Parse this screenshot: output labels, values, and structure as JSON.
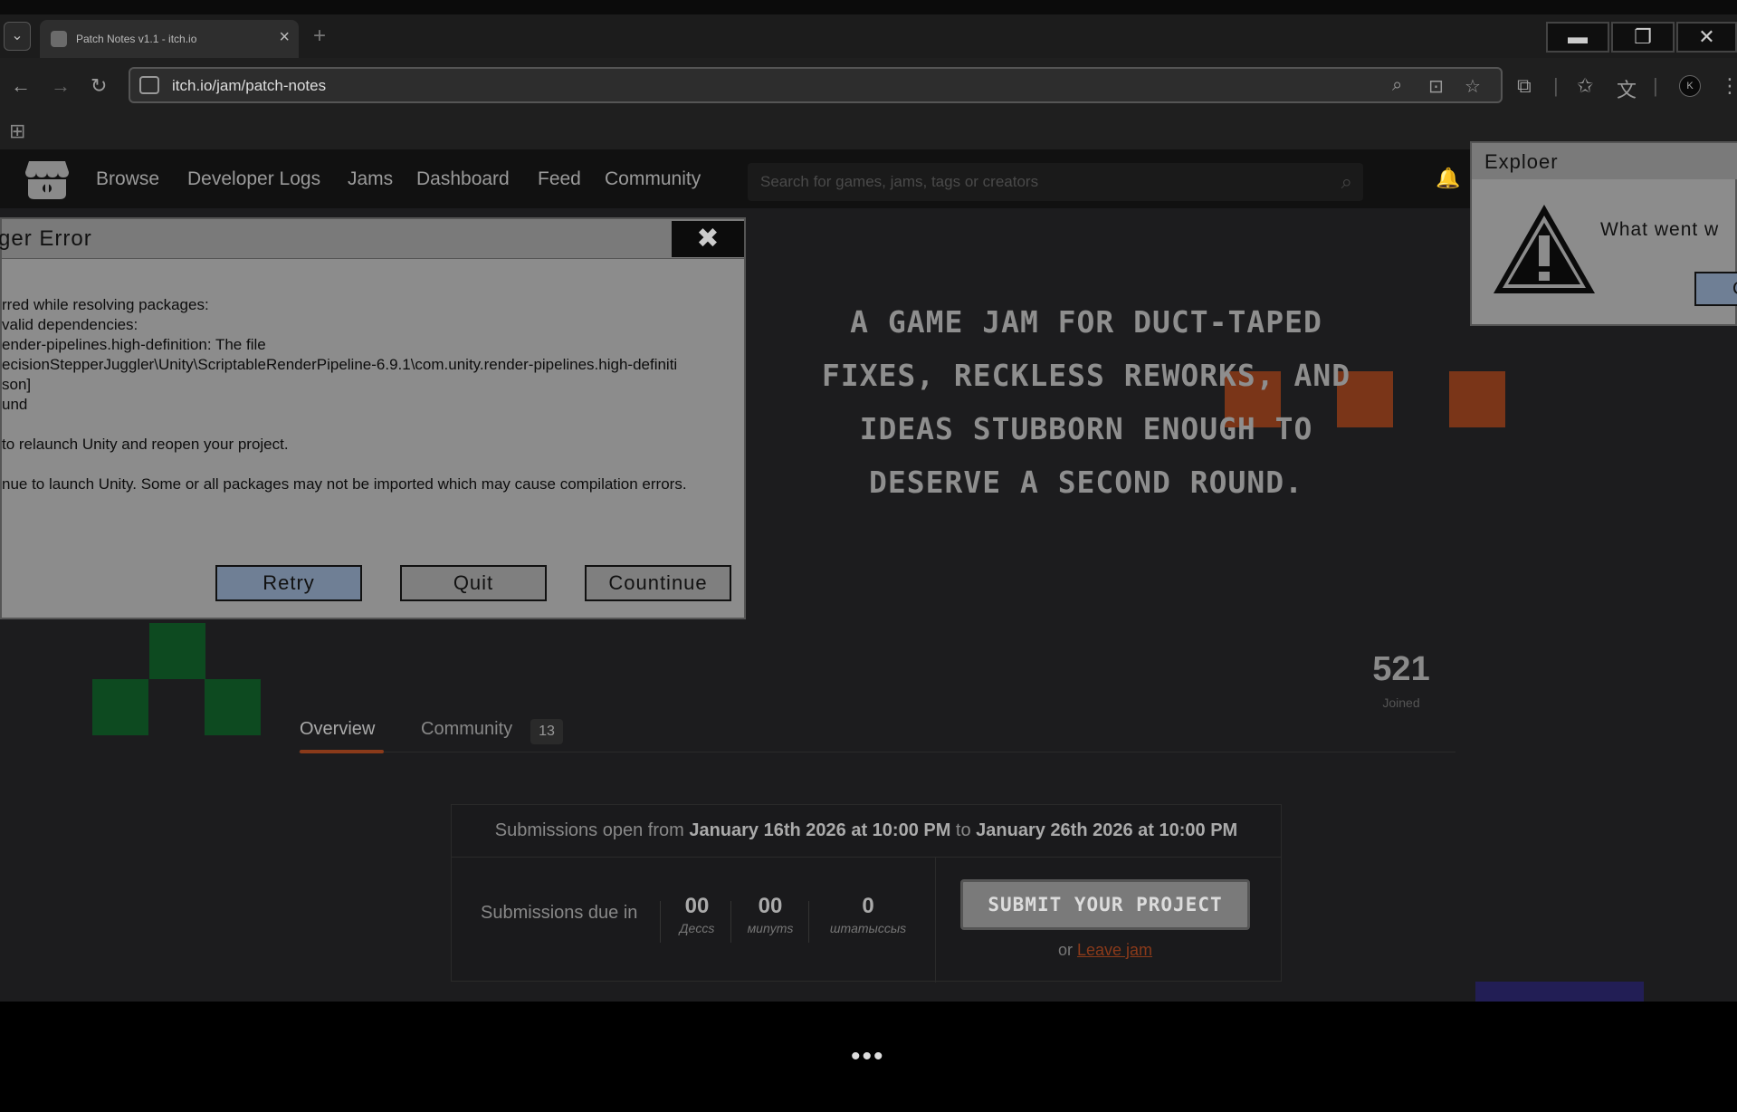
{
  "browser": {
    "tab_title": "Patch Notes v1.1 - itch.io",
    "tab_close": "×",
    "new_tab": "+",
    "url": "itch.io/jam/patch-notes",
    "avatar_letter": "K",
    "win_minimize": "▬",
    "win_restore": "❐",
    "win_close": "✕",
    "dropdown": "⌄"
  },
  "header": {
    "nav": [
      "Browse",
      "Developer Logs",
      "Jams",
      "Dashboard",
      "Feed",
      "Community"
    ],
    "search_placeholder": "Search for games, jams, tags or creators"
  },
  "hero": {
    "lines": [
      "A GAME JAM FOR DUCT-TAPED",
      "FIXES, RECKLESS REWORKS, AND",
      "IDEAS STUBBORN ENOUGH TO",
      "DESERVE A SECOND ROUND."
    ]
  },
  "stats": {
    "joined_count": "521",
    "joined_label": "Joined"
  },
  "tabs": {
    "overview": "Overview",
    "community": "Community",
    "community_count": "13"
  },
  "submissions": {
    "open_prefix": "Submissions open from ",
    "start": "January 16th 2026 at 10:00 PM",
    "to": " to ",
    "end": "January 26th 2026 at 10:00 PM",
    "due_label": "Submissions due in",
    "countdown": [
      {
        "value": "00",
        "unit": "Дecсs"
      },
      {
        "value": "00",
        "unit": "мunyms"
      },
      {
        "value": "0",
        "unit": "шmamысcыs"
      }
    ],
    "submit_label": "SUBMIT YOUR PROJECT",
    "or": "or ",
    "leave": "Leave jam"
  },
  "error_dialog": {
    "title": "ger Error",
    "close": "✖",
    "lines": [
      "rred while resolving packages:",
      "valid dependencies:",
      "ender-pipelines.high-definition: The file",
      "ecisionStepperJuggler\\Unity\\ScriptableRenderPipeline-6.9.1\\com.unity.render-pipelines.high-definiti",
      "son]",
      "und",
      "",
      " to relaunch Unity and reopen your project.",
      "",
      "nue to launch Unity. Some or all packages may not be imported which may cause compilation errors."
    ],
    "buttons": {
      "retry": "Retry",
      "quit": "Quit",
      "continue": "Countinue"
    }
  },
  "explorer_dialog": {
    "title": "Exploer",
    "message": "What went w",
    "button": "C"
  },
  "bottom": {
    "dots": "•••"
  },
  "colors": {
    "accent_orange": "#7a3518",
    "pixel_green": "#0d4a20",
    "dialog_gray": "#8c8c8c",
    "primary_button": "#6f7f95"
  }
}
